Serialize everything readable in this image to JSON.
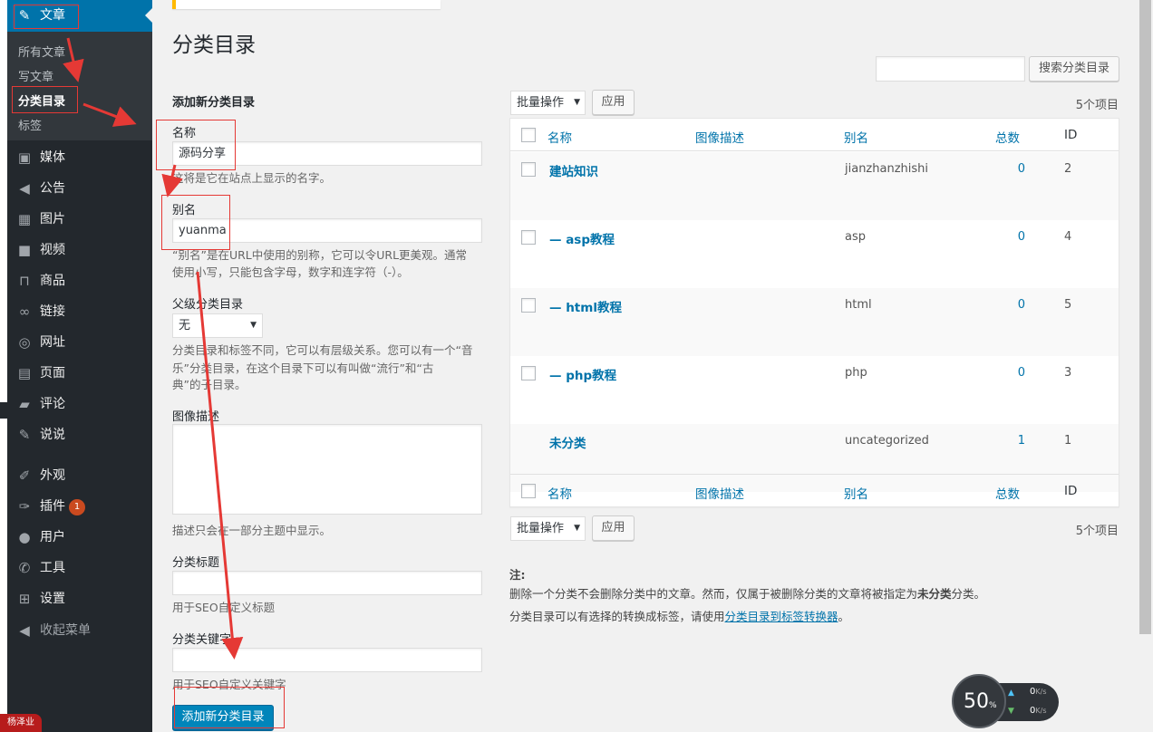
{
  "menu": {
    "posts": "文章",
    "submenu": [
      "所有文章",
      "写文章",
      "分类目录",
      "标签"
    ],
    "items": [
      {
        "icon": "media-icon",
        "glyph": "▣",
        "label": "媒体"
      },
      {
        "icon": "megaphone-icon",
        "glyph": "◀",
        "label": "公告"
      },
      {
        "icon": "image-icon",
        "glyph": "▦",
        "label": "图片"
      },
      {
        "icon": "video-icon",
        "glyph": "■",
        "label": "视频"
      },
      {
        "icon": "cart-icon",
        "glyph": "⊓",
        "label": "商品"
      },
      {
        "icon": "link-icon",
        "glyph": "∞",
        "label": "链接"
      },
      {
        "icon": "globe-icon",
        "glyph": "◎",
        "label": "网址"
      },
      {
        "icon": "page-icon",
        "glyph": "▤",
        "label": "页面"
      },
      {
        "icon": "comment-icon",
        "glyph": "▰",
        "label": "评论"
      },
      {
        "icon": "pin-icon",
        "glyph": "✎",
        "label": "说说"
      },
      {
        "icon": "brush-icon",
        "glyph": "✐",
        "label": "外观"
      },
      {
        "icon": "plugin-icon",
        "glyph": "✑",
        "label": "插件",
        "badge": "1"
      },
      {
        "icon": "user-icon",
        "glyph": "●",
        "label": "用户"
      },
      {
        "icon": "wrench-icon",
        "glyph": "✆",
        "label": "工具"
      },
      {
        "icon": "settings-icon",
        "glyph": "⊞",
        "label": "设置"
      }
    ],
    "collapse": "收起菜单"
  },
  "stamp": "杨泽业",
  "page_title": "分类目录",
  "search": {
    "value": "",
    "button": "搜索分类目录"
  },
  "form": {
    "heading": "添加新分类目录",
    "name_label": "名称",
    "name_value": "源码分享",
    "name_desc": "这将是它在站点上显示的名字。",
    "slug_label": "别名",
    "slug_value": "yuanma",
    "slug_desc_1": "“别名”是在URL中使用的别称，它可以令URL更美观。通常",
    "slug_desc_2": "使用小写，只能包含字母，数字和连字符（-）。",
    "parent_label": "父级分类目录",
    "parent_value": "无",
    "parent_desc_1": "分类目录和标签不同，它可以有层级关系。您可以有一个“音",
    "parent_desc_2": "乐”分类目录，在这个目录下可以有叫做“流行”和“古",
    "parent_desc_3": "典”的子目录。",
    "image_label": "图像描述",
    "image_desc": "描述只会在一部分主题中显示。",
    "seo_title_label": "分类标题",
    "seo_title_desc": "用于SEO自定义标题",
    "seo_kw_label": "分类关键字",
    "seo_kw_desc": "用于SEO自定义关键字",
    "submit": "添加新分类目录"
  },
  "table": {
    "bulk": "批量操作",
    "apply": "应用",
    "count": "5个项目",
    "columns": [
      "名称",
      "图像描述",
      "别名",
      "总数",
      "ID"
    ],
    "rows": [
      {
        "name": "建站知识",
        "slug": "jianzhanzhishi",
        "count": "0",
        "id": "2"
      },
      {
        "name": "— asp教程",
        "slug": "asp",
        "count": "0",
        "id": "4"
      },
      {
        "name": "— html教程",
        "slug": "html",
        "count": "0",
        "id": "5"
      },
      {
        "name": "— php教程",
        "slug": "php",
        "count": "0",
        "id": "3"
      },
      {
        "name": "未分类",
        "slug": "uncategorized",
        "count": "1",
        "id": "1"
      }
    ]
  },
  "notes": {
    "title": "注:",
    "line1_a": "删除一个分类不会删除分类中的文章。然而，仅属于被删除分类的文章将被指定为",
    "line1_b": "未分类",
    "line1_c": "分类。",
    "line2_a": "分类目录可以有选择的转换成标签，请使用",
    "line2_link": "分类目录到标签转换器",
    "line2_c": "。"
  },
  "net_widget": {
    "percent": "50",
    "percent_sign": "%",
    "up": "0",
    "down": "0",
    "unit": "K/s"
  },
  "colors": {
    "menu_bg": "#23282d",
    "menu_active": "#0073aa",
    "link": "#0073aa",
    "annotation": "#e53935",
    "primary_button": "#0085ba"
  }
}
